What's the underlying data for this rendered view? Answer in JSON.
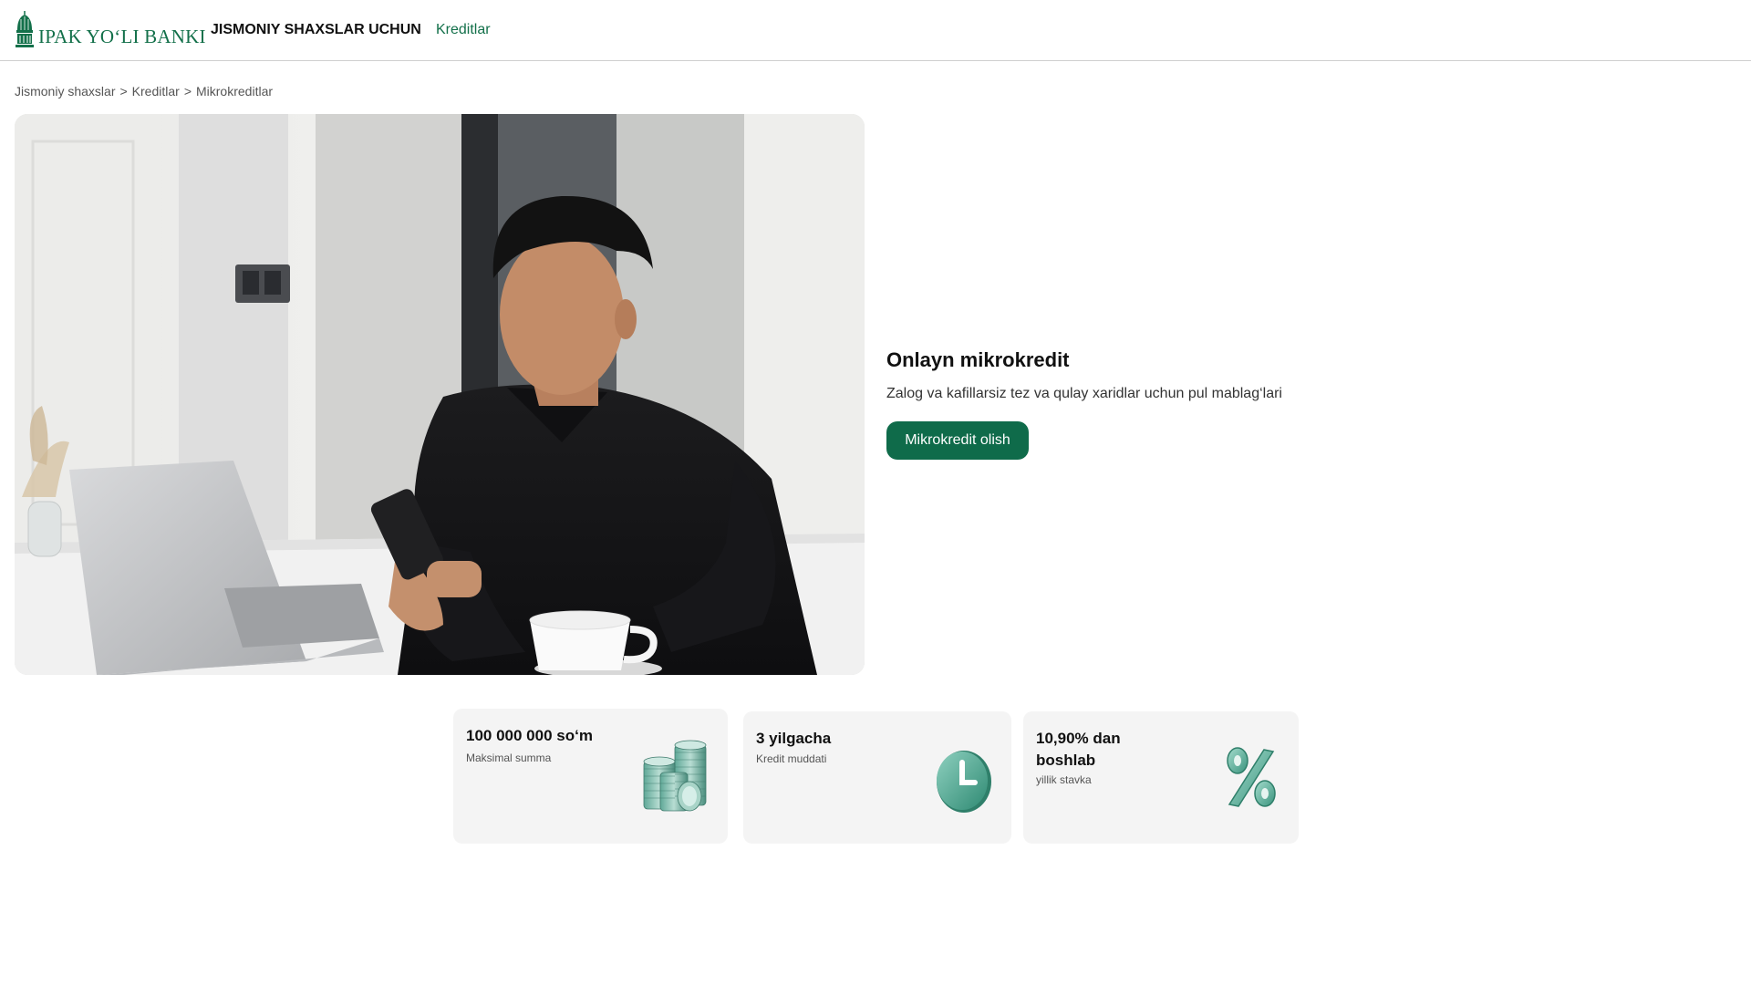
{
  "header": {
    "logo_text": "IPAK YO‘LI BANKI",
    "nav_main": "JISMONIY SHAXSLAR UCHUN",
    "nav_sub": "Kreditlar",
    "brand_color": "#13704a"
  },
  "breadcrumb": {
    "items": [
      "Jismoniy shaxslar",
      "Kreditlar",
      "Mikrokreditlar"
    ],
    "separator": ">"
  },
  "hero": {
    "title": "Onlayn mikrokredit",
    "subtitle": "Zalog va kafillarsiz tez va qulay xaridlar uchun pul mablag‘lari",
    "cta_label": "Mikrokredit olish",
    "cta_color": "#0f6b4a"
  },
  "features": [
    {
      "value": "100 000 000 so‘m",
      "label": "Maksimal summa",
      "icon": "coins-stack-icon"
    },
    {
      "value": "3 yilgacha",
      "label": "Kredit muddati",
      "icon": "clock-icon"
    },
    {
      "value": "10,90% dan boshlab",
      "label": "yillik stavka",
      "icon": "percent-icon"
    }
  ]
}
